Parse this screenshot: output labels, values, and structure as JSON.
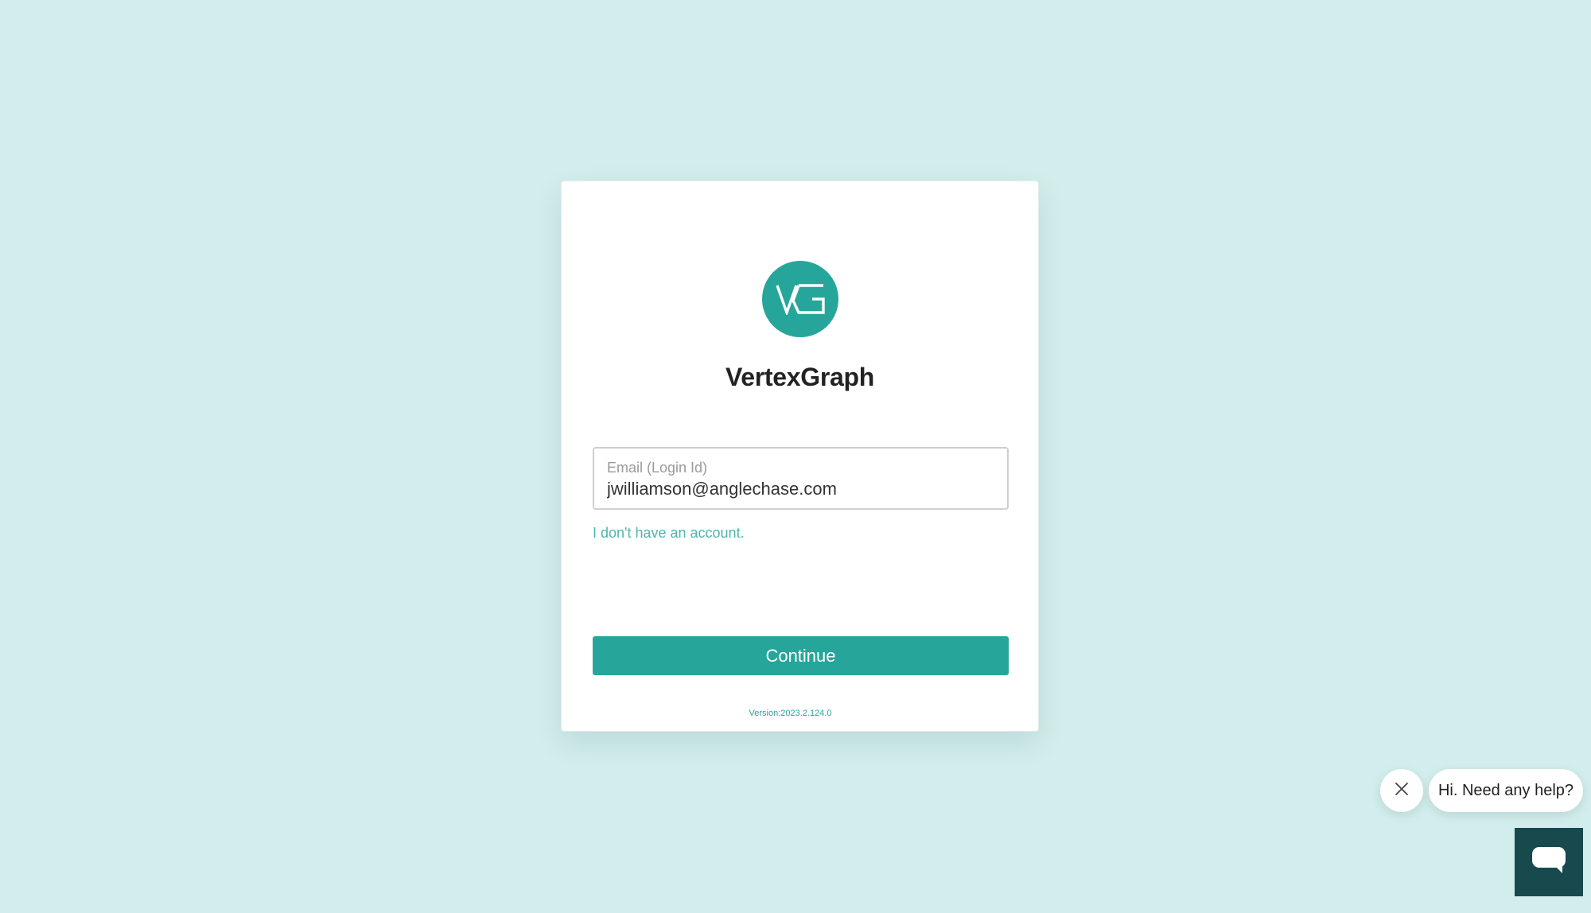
{
  "app": {
    "title": "VertexGraph",
    "logo_icon": "vg-logo-icon",
    "brand_color": "#26a69a"
  },
  "login": {
    "email_label": "Email (Login Id)",
    "email_value": "jwilliamson@anglechase.com",
    "no_account_link": "I don't have an account.",
    "continue_label": "Continue",
    "version": "Version:2023.2.124.0"
  },
  "chat": {
    "greeting": "Hi. Need any help?",
    "close_icon": "close-icon",
    "launcher_icon": "chat-bubble-icon",
    "launcher_color": "#17494d"
  },
  "colors": {
    "background": "#d1edec",
    "link": "#4db6ac"
  }
}
